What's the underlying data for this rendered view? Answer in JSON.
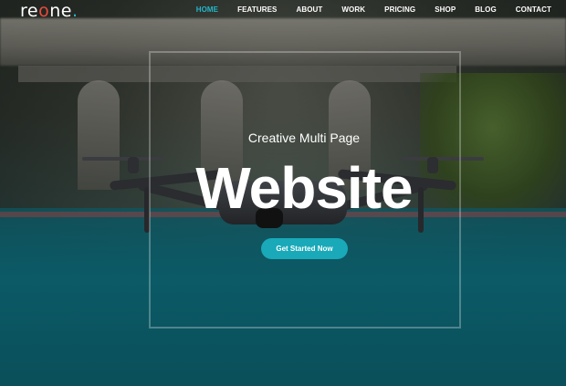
{
  "logo": {
    "part1": "re",
    "part2": "o",
    "part3": "ne",
    "part4": "."
  },
  "nav": {
    "items": [
      "HOME",
      "FEATURES",
      "ABOUT",
      "WORK",
      "PRICING",
      "SHOP",
      "BLOG",
      "CONTACT"
    ],
    "active": "HOME"
  },
  "hero": {
    "subtitle": "Creative Multi Page",
    "title": "Website",
    "cta_label": "Get Started Now"
  },
  "colors": {
    "accent": "#23b6c9",
    "button": "#19a9b8",
    "logo_o": "#e84b3c"
  }
}
